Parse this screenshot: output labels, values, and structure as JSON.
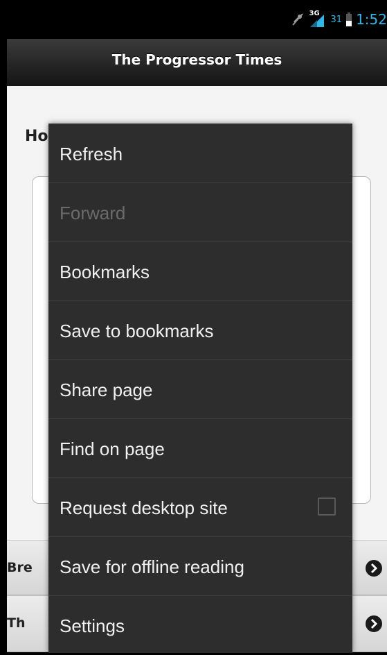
{
  "status": {
    "network_label": "3G",
    "battery_level": "31",
    "time": "1:52"
  },
  "app": {
    "title": "The Progressor Times"
  },
  "content": {
    "heading_visible": "Ho"
  },
  "list": {
    "rows": [
      {
        "label": "Bre"
      },
      {
        "label": "Th"
      }
    ]
  },
  "menu": {
    "items": [
      {
        "label": "Refresh"
      },
      {
        "label": "Forward"
      },
      {
        "label": "Bookmarks"
      },
      {
        "label": "Save to bookmarks"
      },
      {
        "label": "Share page"
      },
      {
        "label": "Find on page"
      },
      {
        "label": "Request desktop site"
      },
      {
        "label": "Save for offline reading"
      },
      {
        "label": "Settings"
      }
    ]
  },
  "colors": {
    "status_accent": "#33b5e5",
    "menu_bg": "#2d2d2d",
    "disabled_text": "#6b6b6b"
  },
  "icons": {
    "mute": "mute-icon",
    "signal": "signal-icon",
    "battery": "battery-icon",
    "chevron": "chevron-right-icon"
  },
  "state": {
    "request_desktop_site_checked": false,
    "forward_enabled": false
  }
}
